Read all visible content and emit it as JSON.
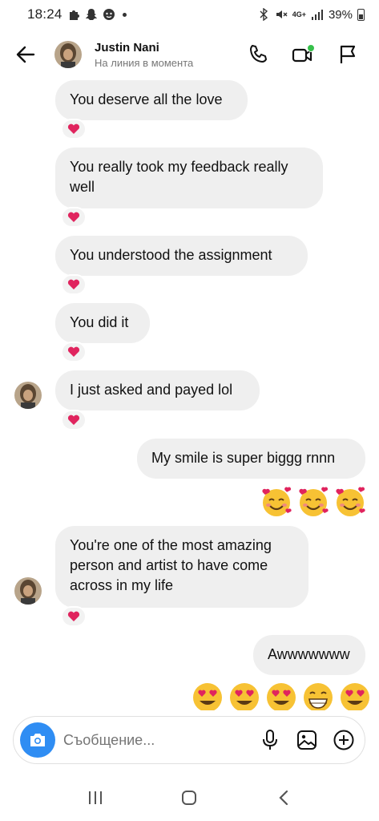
{
  "status_bar": {
    "time": "18:24",
    "network": "4G+",
    "battery": "39%"
  },
  "header": {
    "name": "Justin Nani",
    "status": "На линия в момента"
  },
  "messages": [
    {
      "id": "m1",
      "direction": "in",
      "text": "You deserve all the love",
      "reaction": "heart"
    },
    {
      "id": "m2",
      "direction": "in",
      "text": "You really took my feedback really well",
      "reaction": "heart"
    },
    {
      "id": "m3",
      "direction": "in",
      "text": "You understood the assignment",
      "reaction": "heart"
    },
    {
      "id": "m4",
      "direction": "in",
      "text": "You did it",
      "reaction": "heart"
    },
    {
      "id": "m5",
      "direction": "in",
      "text": "I just asked and payed lol",
      "reaction": "heart"
    },
    {
      "id": "m6",
      "direction": "out",
      "text": "My smile is super biggg rnnn"
    },
    {
      "id": "m7",
      "direction": "out",
      "emoji": [
        "smiling-face-with-hearts",
        "smiling-face-with-hearts",
        "smiling-face-with-hearts"
      ]
    },
    {
      "id": "m8",
      "direction": "in",
      "text": "You're one of the most amazing person and artist to have come across in my life",
      "reaction": "heart"
    },
    {
      "id": "m9",
      "direction": "out",
      "text": "Awwwwwww"
    },
    {
      "id": "m10",
      "direction": "out",
      "emoji": [
        "heart-eyes",
        "heart-eyes",
        "heart-eyes",
        "grinning-face",
        "heart-eyes"
      ]
    }
  ],
  "composer": {
    "placeholder": "Съобщение..."
  },
  "colors": {
    "bubble": "#efefef",
    "camera": "#2f8df3",
    "heart": "#e0245e",
    "active": "#36c04b"
  }
}
